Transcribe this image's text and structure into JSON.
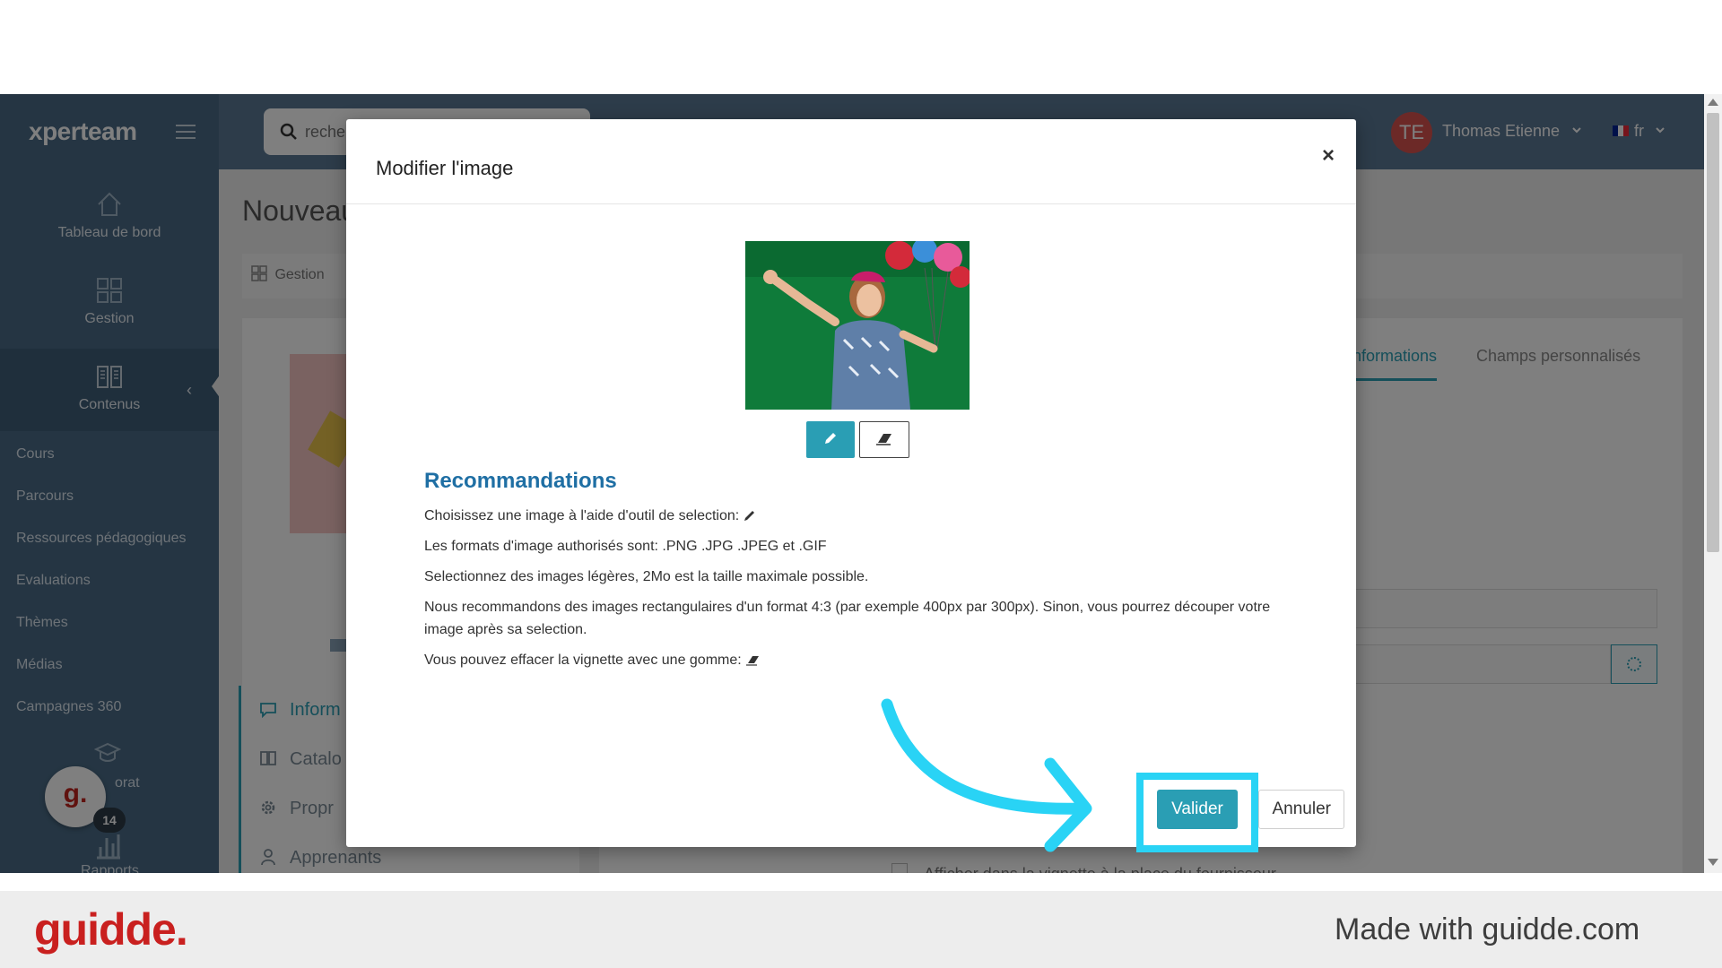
{
  "app": {
    "logo": "xperteam",
    "search": {
      "placeholder": "reche"
    },
    "user": {
      "initials": "TE",
      "name": "Thomas Etienne"
    },
    "language": "fr"
  },
  "sidebar": {
    "main_items": [
      {
        "label": "Tableau de bord",
        "icon": "home-icon"
      },
      {
        "label": "Gestion",
        "icon": "grid-icon"
      },
      {
        "label": "Contenus",
        "icon": "book-icon",
        "active": true
      }
    ],
    "sub_items": [
      "Cours",
      "Parcours",
      "Ressources pédagogiques",
      "Evaluations",
      "Thèmes",
      "Médias",
      "Campagnes 360"
    ],
    "partial_items": [
      "orat",
      "Rapports"
    ],
    "user_badge": {
      "letter": "g.",
      "count": "14"
    }
  },
  "page": {
    "title": "Nouveau",
    "breadcrumb": "Gestion",
    "left_tabs": [
      "Inform",
      "Catalo",
      "Propr",
      "Apprenants"
    ],
    "right_tabs": [
      "nformations",
      "Champs personnalisés"
    ],
    "bottom_text": "Afficher dans la vignette à la place du fournisseur"
  },
  "modal": {
    "title": "Modifier l'image",
    "close_symbol": "×",
    "recommendations_title": "Recommandations",
    "recommendations": [
      "Choisissez une image à l'aide d'outil de selection:",
      "Les formats d'image authorisés sont: .PNG .JPG .JPEG et .GIF",
      "Selectionnez des images légères, 2Mo est la taille maximale possible.",
      "Nous recommandons des images rectangulaires d'un format 4:3 (par exemple 400px par 300px). Sinon, vous pourrez découper votre image après sa selection.",
      "Vous pouvez effacer la vignette avec une gomme:"
    ],
    "buttons": {
      "validate": "Valider",
      "cancel": "Annuler"
    }
  },
  "colors": {
    "accent": "#2a9eb4",
    "highlight": "#29d3f5",
    "sidebar": "#4a6b86",
    "header": "#5b7894",
    "recommendations_title": "#1f6fa4",
    "brand_red": "#c9201f"
  },
  "footer": {
    "brand": "guidde.",
    "made_with": "Made with guidde.com"
  }
}
